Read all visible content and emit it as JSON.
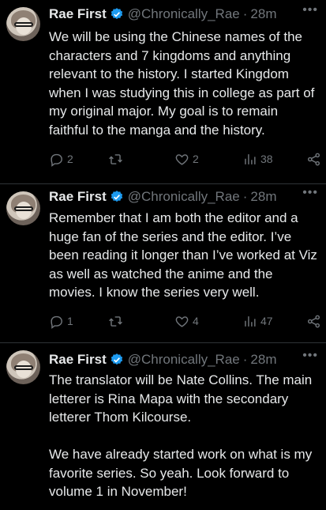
{
  "tweets": [
    {
      "name": "Rae First",
      "handle": "@Chronically_Rae",
      "separator": "·",
      "time": "28m",
      "more": "•••",
      "text": "We will be using the Chinese names of the characters and 7 kingdoms and anything relevant to the history. I started Kingdom when I was studying this in college as part of my original major. My goal is to remain faithful to the manga and the history.",
      "replies": "2",
      "retweets": "",
      "likes": "2",
      "views": "38"
    },
    {
      "name": "Rae First",
      "handle": "@Chronically_Rae",
      "separator": "·",
      "time": "28m",
      "more": "•••",
      "text": "Remember that I am both the editor and a huge fan of the series and the editor. I’ve been reading it longer than I’ve worked at Viz as well as watched the anime and the movies. I know the series very well.",
      "replies": "1",
      "retweets": "",
      "likes": "4",
      "views": "47"
    },
    {
      "name": "Rae First",
      "handle": "@Chronically_Rae",
      "separator": "·",
      "time": "28m",
      "more": "•••",
      "text": "The translator will be Nate Collins. The main letterer is Rina Mapa with the secondary letterer Thom Kilcourse.\n\nWe have already started work on what is my favorite series. So yeah. Look forward to volume 1 in November!"
    }
  ],
  "colors": {
    "accent": "#1d9bf0",
    "muted": "#71767b",
    "text": "#e7e9ea",
    "background": "#000000"
  }
}
